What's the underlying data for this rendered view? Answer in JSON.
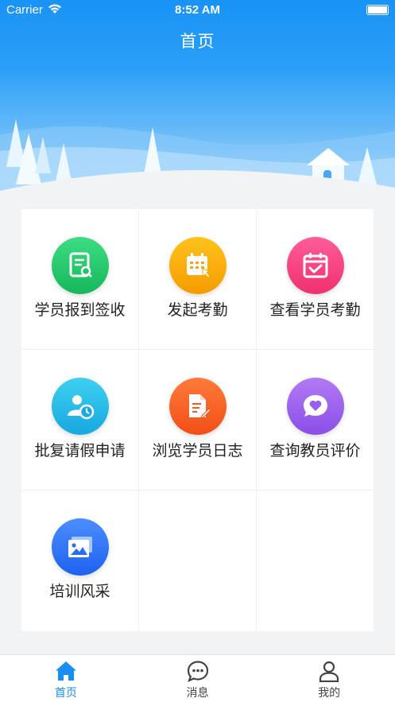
{
  "status_bar": {
    "carrier": "Carrier",
    "time": "8:52 AM"
  },
  "header": {
    "title": "首页"
  },
  "grid": {
    "items": [
      {
        "label": "学员报到签收",
        "icon": "document-search-icon",
        "color_from": "#3ddc84",
        "color_to": "#16b85a"
      },
      {
        "label": "发起考勤",
        "icon": "calendar-grid-icon",
        "color_from": "#ffc21d",
        "color_to": "#f59b00"
      },
      {
        "label": "查看学员考勤",
        "icon": "calendar-check-icon",
        "color_from": "#ff5c9a",
        "color_to": "#f0306f"
      },
      {
        "label": "批复请假申请",
        "icon": "user-clock-icon",
        "color_from": "#3ed0f0",
        "color_to": "#17a8e0"
      },
      {
        "label": "浏览学员日志",
        "icon": "document-edit-icon",
        "color_from": "#ff7b3a",
        "color_to": "#f24e16"
      },
      {
        "label": "查询教员评价",
        "icon": "heart-chat-icon",
        "color_from": "#b27af5",
        "color_to": "#8a4ee8"
      },
      {
        "label": "培训风采",
        "icon": "photo-gallery-icon",
        "color_from": "#4c8dff",
        "color_to": "#1d62f0"
      }
    ]
  },
  "tabbar": {
    "tabs": [
      {
        "label": "首页",
        "icon": "home-icon",
        "active": true
      },
      {
        "label": "消息",
        "icon": "message-icon",
        "active": false
      },
      {
        "label": "我的",
        "icon": "user-icon",
        "active": false
      }
    ]
  },
  "colors": {
    "accent": "#1a8df5",
    "background": "#f2f3f5"
  }
}
